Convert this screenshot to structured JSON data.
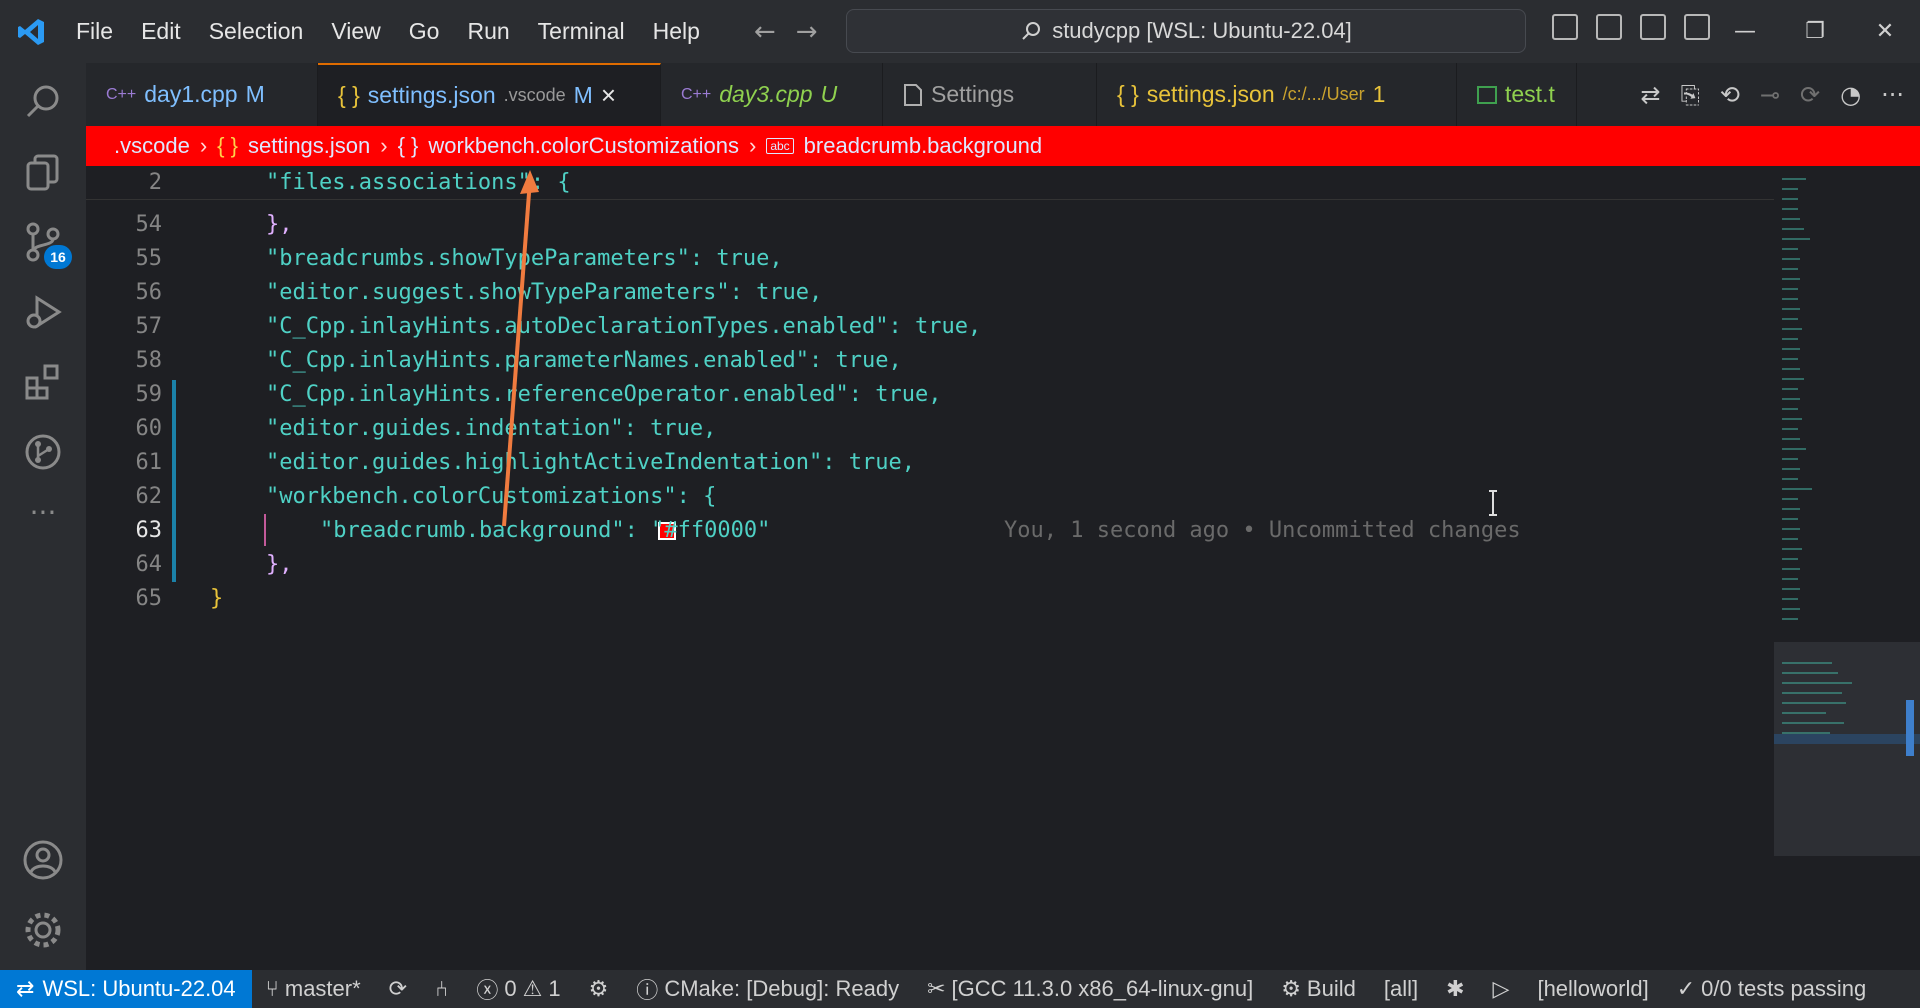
{
  "titlebar": {
    "menu": [
      "File",
      "Edit",
      "Selection",
      "View",
      "Go",
      "Run",
      "Terminal",
      "Help"
    ],
    "command_center": "studycpp [WSL: Ubuntu-22.04]"
  },
  "activity": {
    "scm_badge": "16"
  },
  "tabs": [
    {
      "label": "day1.cpp",
      "sub": "M",
      "icon": "C++"
    },
    {
      "label": "settings.json",
      "sub": ".vscode",
      "status": "M",
      "close": "×",
      "icon": "{ }"
    },
    {
      "label": "day3.cpp",
      "sub": "U",
      "icon": "C++"
    },
    {
      "label": "Settings",
      "sub": "",
      "icon": "file-icon"
    },
    {
      "label": "settings.json",
      "sub": "/c:/.../User",
      "status": "1",
      "icon": "{ }"
    },
    {
      "label": "test.t",
      "sub": "",
      "icon": "table-icon"
    }
  ],
  "breadcrumb": {
    "items": [
      ".vscode",
      "settings.json",
      "workbench.colorCustomizations",
      "breadcrumb.background"
    ],
    "color": "#ff0000"
  },
  "editor": {
    "lines": [
      {
        "num": "2",
        "text": "\"files.associations\": {"
      },
      {
        "num": "54",
        "text": "},"
      },
      {
        "num": "55",
        "text": "\"breadcrumbs.showTypeParameters\": true,"
      },
      {
        "num": "56",
        "text": "\"editor.suggest.showTypeParameters\": true,"
      },
      {
        "num": "57",
        "text": "\"C_Cpp.inlayHints.autoDeclarationTypes.enabled\": true,"
      },
      {
        "num": "58",
        "text": "\"C_Cpp.inlayHints.parameterNames.enabled\": true,"
      },
      {
        "num": "59",
        "text": "\"C_Cpp.inlayHints.referenceOperator.enabled\": true,"
      },
      {
        "num": "60",
        "text": "\"editor.guides.indentation\": true,"
      },
      {
        "num": "61",
        "text": "\"editor.guides.highlightActiveIndentation\": true,"
      },
      {
        "num": "62",
        "text": "\"workbench.colorCustomizations\": {"
      },
      {
        "num": "63",
        "text": "\"breadcrumb.background\": \"#ff0000\""
      },
      {
        "num": "64",
        "text": "},"
      },
      {
        "num": "65",
        "text": "}"
      }
    ],
    "blame": "You, 1 second ago • Uncommitted changes",
    "swatch_color": "#ff0000"
  },
  "statusbar": {
    "remote": "WSL: Ubuntu-22.04",
    "branch": "master*",
    "problems": "0",
    "warnings": "1",
    "cmake": "CMake: [Debug]: Ready",
    "kit": "[GCC 11.3.0 x86_64-linux-gnu]",
    "build": "Build",
    "target": "[all]",
    "launch": "[helloworld]",
    "tests": "0/0 tests passing"
  }
}
